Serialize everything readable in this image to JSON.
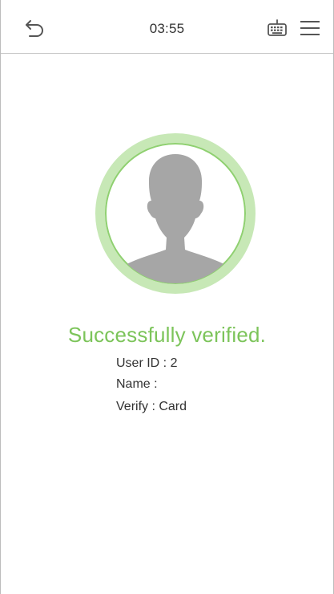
{
  "status_bar": {
    "time": "03:55",
    "back_icon": "back-arrow-icon",
    "keyboard_icon": "keyboard-icon",
    "menu_icon": "hamburger-menu-icon"
  },
  "verification": {
    "title": "Successfully verified.",
    "user_id_line": "User ID : 2",
    "name_line": "Name :",
    "verify_line": "Verify : Card"
  },
  "colors": {
    "success_green": "#7cc45a",
    "ring_outer": "#c7e8b6",
    "ring_inner": "#8fd070",
    "silhouette": "#a6a6a6"
  }
}
